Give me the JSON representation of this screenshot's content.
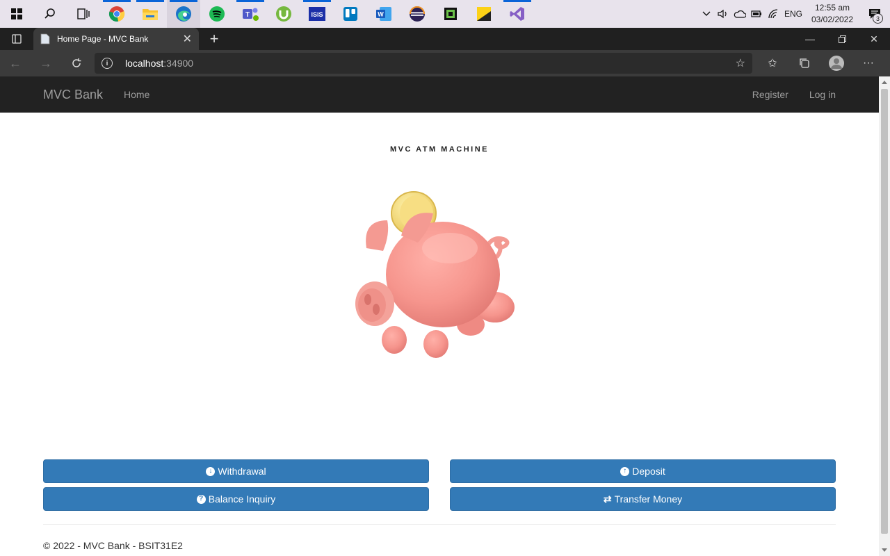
{
  "taskbar": {
    "apps": [
      "windows-start",
      "search",
      "task-view",
      "chrome",
      "file-explorer",
      "edge",
      "spotify",
      "teams",
      "utorrent",
      "isis",
      "trello",
      "word",
      "eclipse",
      "cpu-z",
      "sticky-notes",
      "visual-studio"
    ],
    "language": "ENG",
    "time": "12:55 am",
    "date": "03/02/2022",
    "notification_count": "3"
  },
  "browser": {
    "tab_title": "Home Page - MVC Bank",
    "url_host": "localhost",
    "url_port": ":34900"
  },
  "site": {
    "brand": "MVC Bank",
    "nav": {
      "home": "Home",
      "register": "Register",
      "login": "Log in"
    },
    "heading": "MVC ATM MACHINE",
    "buttons": {
      "withdrawal": "Withdrawal",
      "deposit": "Deposit",
      "balance": "Balance Inquiry",
      "transfer": "Transfer Money"
    },
    "footer": "© 2022 - MVC Bank - BSIT31E2"
  },
  "colors": {
    "primary": "#337ab7",
    "navbar": "#222222"
  }
}
